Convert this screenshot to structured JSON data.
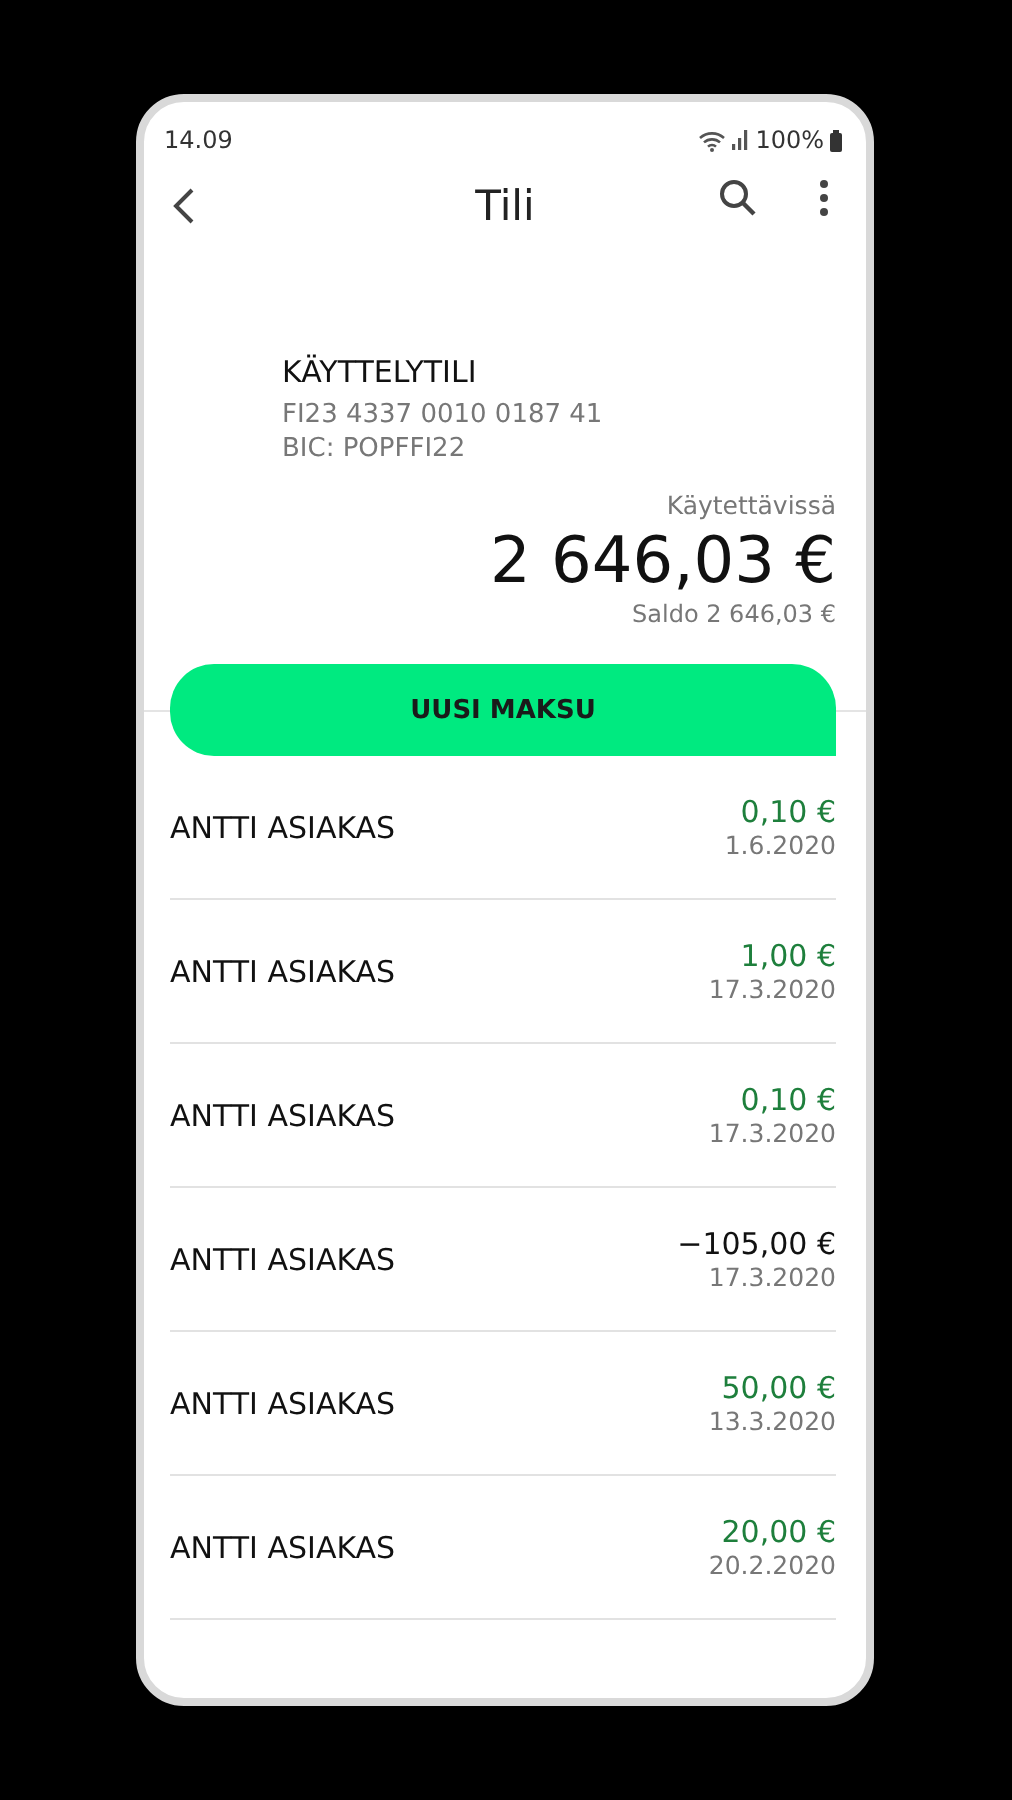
{
  "status_bar": {
    "time": "14.09",
    "battery": "100%"
  },
  "header": {
    "title": "Tili"
  },
  "account": {
    "name": "KÄYTTELYTILI",
    "iban": "FI23 4337 0010 0187 41",
    "bic": "BIC: POPFFI22",
    "available_label": "Käytettävissä",
    "available": "2 646,03 €",
    "balance": "Saldo 2 646,03 €"
  },
  "action_button": "UUSI MAKSU",
  "transactions": [
    {
      "name": "ANTTI ASIAKAS",
      "amount": "0,10 €",
      "date": "1.6.2020",
      "kind": "incoming"
    },
    {
      "name": "ANTTI ASIAKAS",
      "amount": "1,00 €",
      "date": "17.3.2020",
      "kind": "incoming"
    },
    {
      "name": "ANTTI ASIAKAS",
      "amount": "0,10 €",
      "date": "17.3.2020",
      "kind": "incoming"
    },
    {
      "name": "ANTTI ASIAKAS",
      "amount": "−105,00 €",
      "date": "17.3.2020",
      "kind": "outgoing"
    },
    {
      "name": "ANTTI ASIAKAS",
      "amount": "50,00 €",
      "date": "13.3.2020",
      "kind": "incoming"
    },
    {
      "name": "ANTTI ASIAKAS",
      "amount": "20,00 €",
      "date": "20.2.2020",
      "kind": "incoming"
    }
  ]
}
